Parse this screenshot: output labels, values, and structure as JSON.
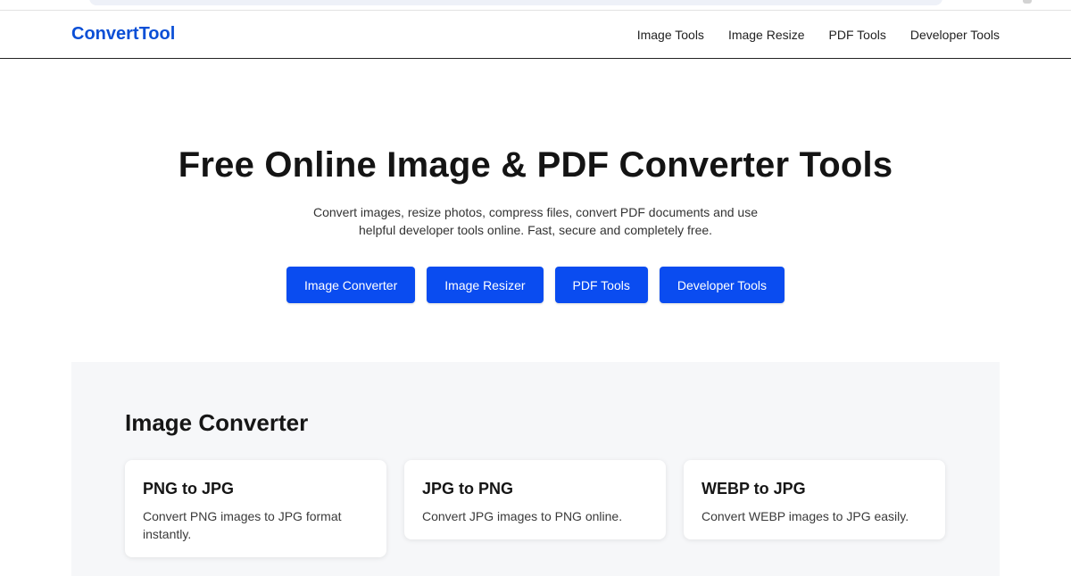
{
  "header": {
    "brand": "ConvertTool",
    "nav": [
      "Image Tools",
      "Image Resize",
      "PDF Tools",
      "Developer Tools"
    ]
  },
  "hero": {
    "title": "Free Online Image & PDF Converter Tools",
    "subtitle": "Convert images, resize photos, compress files, convert PDF documents and use helpful developer tools online. Fast, secure and completely free.",
    "buttons": [
      "Image Converter",
      "Image Resizer",
      "PDF Tools",
      "Developer Tools"
    ]
  },
  "section": {
    "title": "Image Converter",
    "cards": [
      {
        "title": "PNG to JPG",
        "desc": "Convert PNG images to JPG format instantly."
      },
      {
        "title": "JPG to PNG",
        "desc": "Convert JPG images to PNG online."
      },
      {
        "title": "WEBP to JPG",
        "desc": "Convert WEBP images to JPG easily."
      }
    ]
  },
  "colors": {
    "brand": "#0b4fd6",
    "button": "#0a4cf0",
    "section_bg": "#f6f7f9"
  }
}
